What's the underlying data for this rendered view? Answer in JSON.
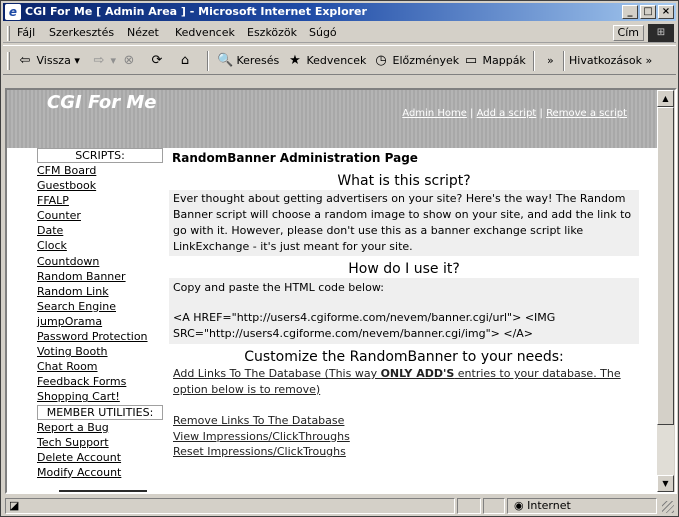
{
  "window": {
    "title": "CGI For Me [ Admin Area ] - Microsoft Internet Explorer",
    "controls": [
      "_",
      "□",
      "×"
    ]
  },
  "menubar": {
    "items": [
      "Fájl",
      "Szerkesztés",
      "Nézet",
      "Kedvencek",
      "Eszközök",
      "Súgó"
    ],
    "address_label": "Cím"
  },
  "toolbar": {
    "back": "Vissza",
    "search": "Keresés",
    "favorites": "Kedvencek",
    "history": "Előzmények",
    "folders": "Mappák",
    "links": "Hivatkozások",
    "chevron": "»"
  },
  "page": {
    "brand": "CGI For Me",
    "admin_links": [
      "Admin Home",
      "Add a script",
      "Remove a script"
    ],
    "sidebar": {
      "scripts_header": "SCRIPTS:",
      "scripts": [
        "CFM Board",
        "Guestbook",
        "FFALP",
        "Counter",
        "Date",
        "Clock",
        "Countdown",
        "Random Banner",
        "Random Link",
        "Search Engine",
        "jumpOrama",
        "Password Protection",
        "Voting Booth",
        "Chat Room",
        "Feedback Forms",
        "Shopping Cart!"
      ],
      "member_header": "MEMBER UTILITIES:",
      "member": [
        "Report a Bug",
        "Tech Support",
        "Delete Account",
        "Modify Account"
      ]
    },
    "main": {
      "title": "RandomBanner Administration Page",
      "what_heading": "What is this script?",
      "what_text": "Ever thought about getting advertisers on your site? Here's the way! The Random Banner script will choose a random image to show on your site, and add the link to go with it. However, please don't use this as a banner exchange script like LinkExchange - it's just meant for your site.",
      "how_heading": "How do I use it?",
      "how_text": "Copy and paste the HTML code below:",
      "code_text": "<A HREF=\"http://users4.cgiforme.com/nevem/banner.cgi/url\"> <IMG SRC=\"http://users4.cgiforme.com/nevem/banner.cgi/img\"> </A>",
      "customize_heading": "Customize the RandomBanner to your needs:",
      "add_link_prefix": "Add Links To The Database (This way ",
      "add_link_bold": "ONLY ADD'S",
      "add_link_suffix": " entries to your database. The option below is to remove)",
      "remove_link": "Remove Links To The Database",
      "view_link": "View Impressions/ClickThroughs",
      "reset_link": "Reset Impressions/ClickTroughs"
    }
  },
  "statusbar": {
    "zone": "Internet"
  }
}
